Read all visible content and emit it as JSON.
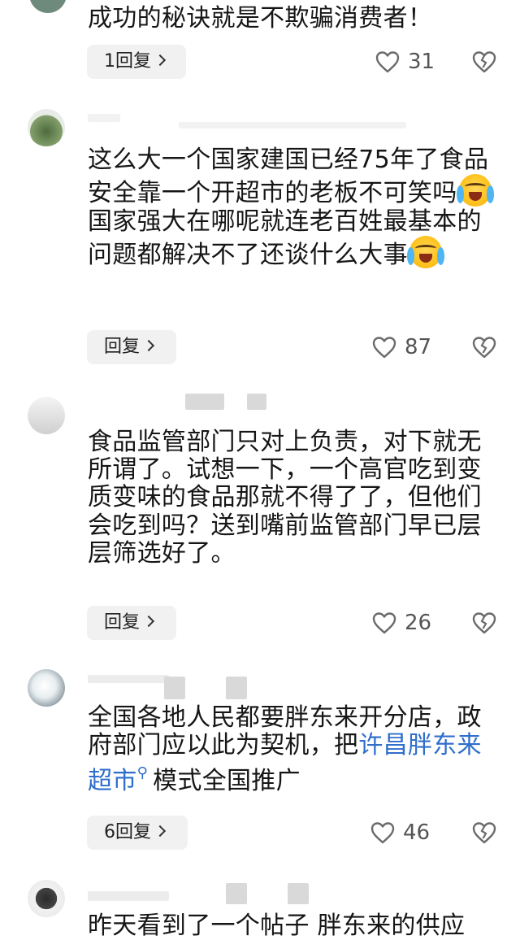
{
  "comments": [
    {
      "text": "成功的秘诀就是不欺骗消费者！",
      "reply_label": "1回复",
      "likes": "31"
    },
    {
      "text_parts": [
        "这么大一个国家建国已经75年了食品安全靠一个开超市的老板不可笑吗",
        "国家强大在哪呢就连老百姓最基本的问题都解决不了还谈什么大事"
      ],
      "reply_label": "回复",
      "likes": "87"
    },
    {
      "text": "食品监管部门只对上负责，对下就无所谓了。试想一下，一个高官吃到变质变味的食品那就不得了了，但他们会吃到吗？送到嘴前监管部门早已层层筛选好了。",
      "reply_label": "回复",
      "likes": "26"
    },
    {
      "text_before": "全国各地人民都要胖东来开分店，政府部门应以此为契机，把",
      "link": "许昌胖东来超市",
      "text_after": "模式全国推广",
      "reply_label": "6回复",
      "likes": "46"
    },
    {
      "text": "昨天看到了一个帖子 胖东来的供应"
    }
  ],
  "icons": {
    "like": "heart-outline-icon",
    "dislike": "broken-heart-icon",
    "emoji": "laughing-crying-emoji",
    "search_marker": "search-icon"
  },
  "colors": {
    "link": "#2f6ecb",
    "reply_bg": "#f1f1f1",
    "icon": "#6b6b6b"
  }
}
